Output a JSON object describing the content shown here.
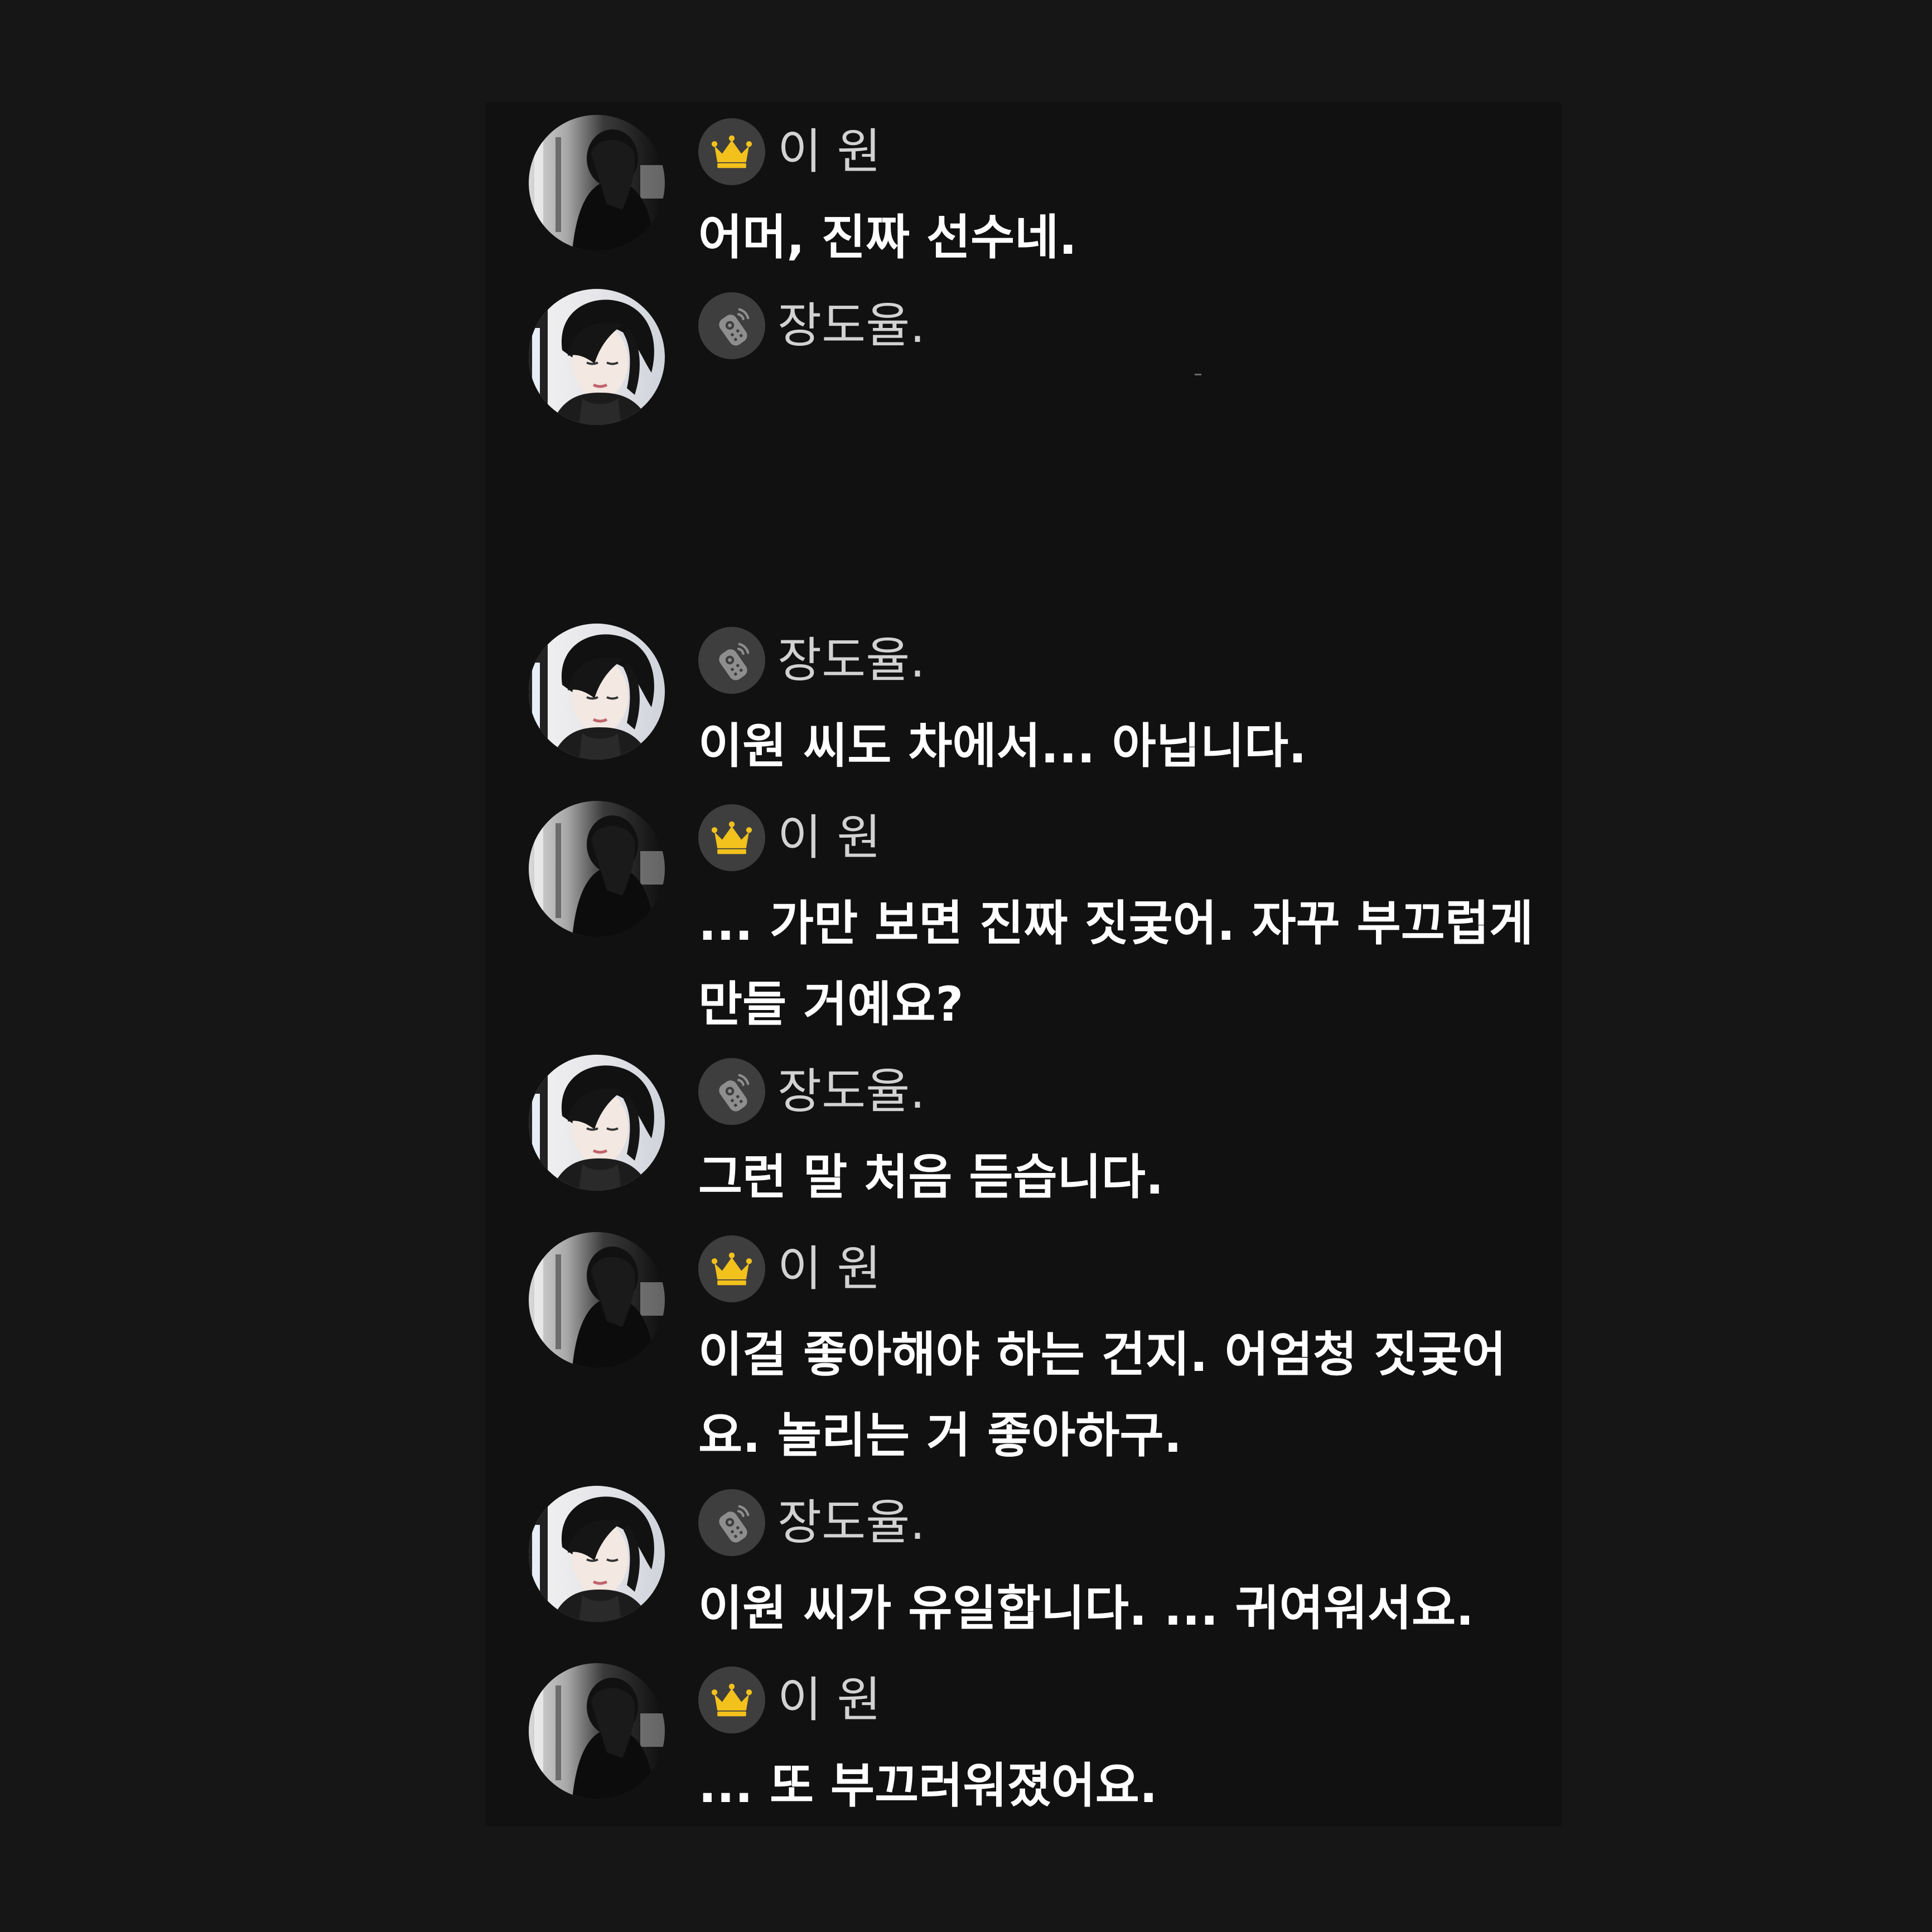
{
  "colors": {
    "page_background": "#161616",
    "panel_background": "#111111",
    "badge_background": "#3e3e3e",
    "crown_gold": "#f2c11c",
    "username_text": "#d2d2d2",
    "message_text": "#ffffff"
  },
  "icons": {
    "crown": "crown-icon",
    "remote": "remote-control-icon"
  },
  "chat": {
    "messages": [
      {
        "sender": "이 원",
        "badge": "crown-icon",
        "text": "어머, 진짜 선수네."
      },
      {
        "sender": "장도율.",
        "badge": "remote-control-icon",
        "text": ""
      },
      {
        "sender": "장도율.",
        "badge": "remote-control-icon",
        "text": "이원 씨도 차에서... 아닙니다."
      },
      {
        "sender": "이 원",
        "badge": "crown-icon",
        "text": "... 가만 보면 진짜 짓궂어. 자꾸 부끄럽게 만들 거예요?"
      },
      {
        "sender": "장도율.",
        "badge": "remote-control-icon",
        "text": "그런 말 처음 듣습니다."
      },
      {
        "sender": "이 원",
        "badge": "crown-icon",
        "text": "이걸 좋아해야 하는 건지. 어엄청 짓궂어요. 놀리는 거 좋아하구."
      },
      {
        "sender": "장도율.",
        "badge": "remote-control-icon",
        "text": "이원 씨가 유일합니다. ... 귀여워서요."
      },
      {
        "sender": "이 원",
        "badge": "crown-icon",
        "text": "... 또 부끄러워졌어요."
      }
    ]
  }
}
